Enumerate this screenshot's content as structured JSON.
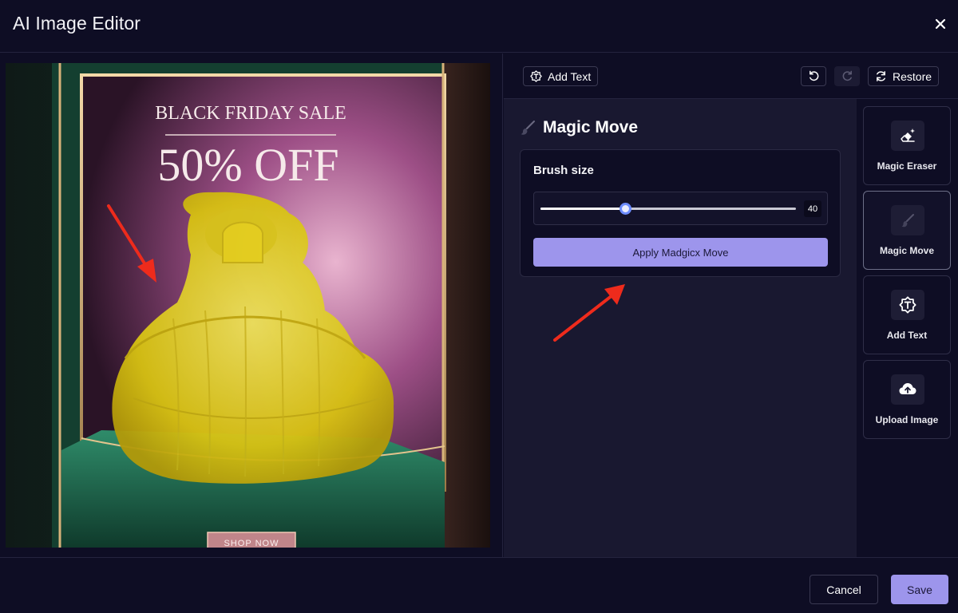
{
  "header": {
    "title": "AI Image Editor"
  },
  "toolbar": {
    "add_text_label": "Add Text",
    "restore_label": "Restore"
  },
  "canvas": {
    "headline": "BLACK FRIDAY SALE",
    "offer": "50% OFF",
    "cta": "SHOP NOW",
    "mask_color": "#e6d21a"
  },
  "panel": {
    "title": "Magic Move",
    "brush_label": "Brush size",
    "brush_value": "40",
    "brush_fraction": 0.33,
    "apply_label": "Apply Madgicx Move"
  },
  "tools": [
    {
      "label": "Magic Eraser",
      "icon": "eraser-icon"
    },
    {
      "label": "Magic Move",
      "icon": "brush-icon",
      "active": true
    },
    {
      "label": "Add Text",
      "icon": "text-icon"
    },
    {
      "label": "Upload Image",
      "icon": "cloud-upload-icon"
    }
  ],
  "footer": {
    "cancel_label": "Cancel",
    "save_label": "Save"
  },
  "colors": {
    "accent": "#9d95ec",
    "background": "#0e0d24",
    "annotation": "#ee2b1c"
  }
}
